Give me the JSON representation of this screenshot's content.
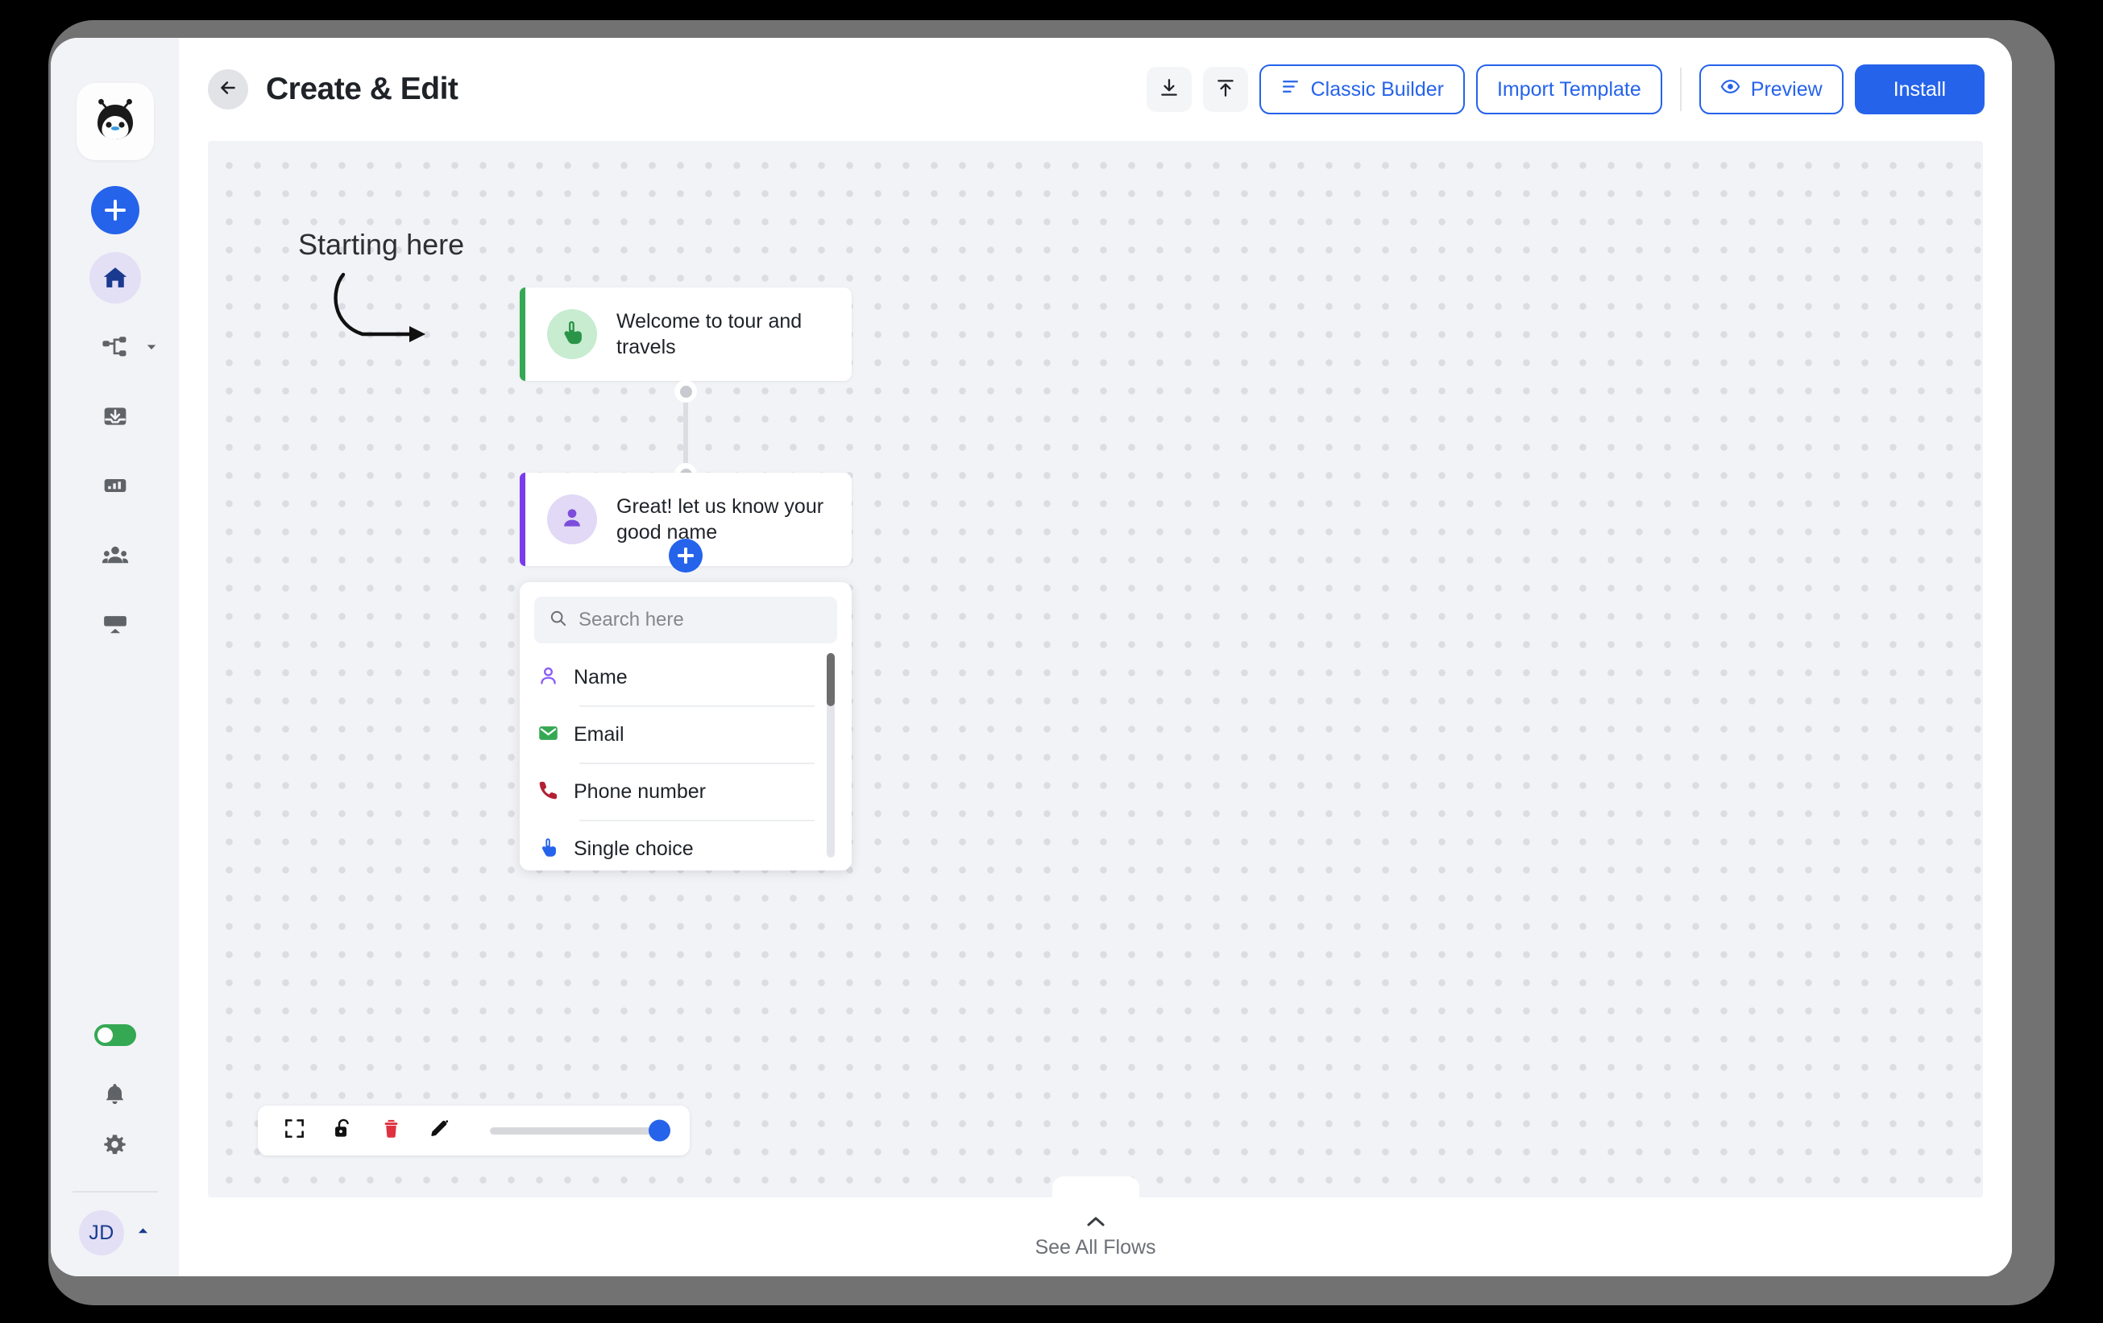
{
  "app": {
    "logo_icon": "penguin-bug-logo"
  },
  "sidebar": {
    "add_button_icon": "plus-icon",
    "items": [
      {
        "icon": "home-icon",
        "name": "home",
        "active": true,
        "has_caret": false
      },
      {
        "icon": "flow-tree-icon",
        "name": "flows",
        "active": false,
        "has_caret": true
      },
      {
        "icon": "inbox-download-icon",
        "name": "inbox",
        "active": false,
        "has_caret": false
      },
      {
        "icon": "analytics-bar-icon",
        "name": "analytics",
        "active": false,
        "has_caret": false
      },
      {
        "icon": "people-group-icon",
        "name": "audience",
        "active": false,
        "has_caret": false
      },
      {
        "icon": "display-board-icon",
        "name": "display",
        "active": false,
        "has_caret": false
      }
    ],
    "bottom": {
      "toggle_state": "on",
      "toggle_icon": "toggle-switch-on",
      "bell_icon": "bell-icon",
      "gear_icon": "gear-icon",
      "avatar_initials": "JD",
      "avatar_caret_icon": "chevron-up-icon"
    }
  },
  "header": {
    "back_icon": "arrow-left-icon",
    "title": "Create & Edit",
    "download_icon": "download-icon",
    "upload_icon": "upload-icon",
    "classic_builder_label": "Classic Builder",
    "classic_builder_icon": "sliders-icon",
    "import_template_label": "Import Template",
    "preview_label": "Preview",
    "preview_icon": "eye-icon",
    "install_label": "Install",
    "accent_color": "#2563eb"
  },
  "canvas": {
    "annotation": "Starting here",
    "arrow_icon": "curved-arrow-icon",
    "nodes": [
      {
        "text": "Welcome to tour and travels",
        "icon": "tap-hand-icon",
        "accent_color": "#34a853",
        "icon_bg": "#c7ecd0",
        "icon_color": "#2a9448"
      },
      {
        "text": "Great! let us know your good name",
        "icon": "person-icon",
        "accent_color": "#7c3aed",
        "icon_bg": "#e1d9f5",
        "icon_color": "#7c4ddb"
      }
    ],
    "add_node_icon": "plus-icon"
  },
  "type_panel": {
    "search_placeholder": "Search here",
    "search_value": "",
    "search_icon": "search-icon",
    "items": [
      {
        "label": "Name",
        "icon": "person-outline-icon",
        "color": "#8b5cf6"
      },
      {
        "label": "Email",
        "icon": "envelope-icon",
        "color": "#34a853"
      },
      {
        "label": "Phone number",
        "icon": "phone-icon",
        "color": "#b32033"
      },
      {
        "label": "Single choice",
        "icon": "tap-hand-icon",
        "color": "#2563eb"
      }
    ]
  },
  "toolbar": {
    "fit_icon": "fit-screen-icon",
    "lock_icon": "unlock-icon",
    "delete_icon": "trash-icon",
    "edit_icon": "pencil-icon",
    "zoom_value": 100
  },
  "footer": {
    "see_all_flows_label": "See All Flows",
    "chevron_icon": "chevron-up-icon"
  }
}
